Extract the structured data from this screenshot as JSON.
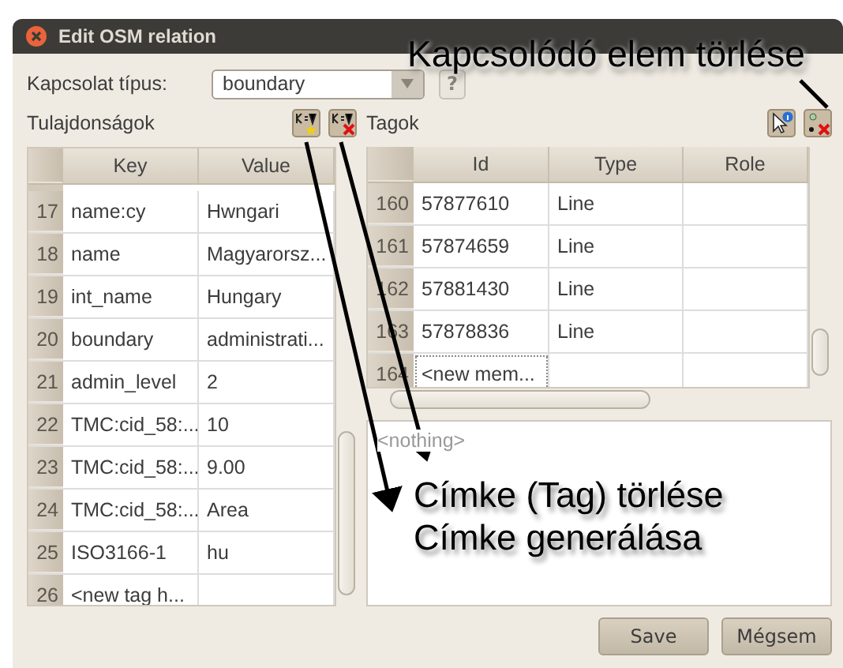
{
  "window": {
    "title": "Edit OSM relation"
  },
  "relation_type": {
    "label": "Kapcsolat típus:",
    "value": "boundary",
    "help": "?"
  },
  "tags": {
    "label": "Tulajdonságok",
    "columns": [
      "Key",
      "Value"
    ],
    "rows": [
      {
        "index": "17",
        "key": "name:cy",
        "value": "Hwngari"
      },
      {
        "index": "18",
        "key": "name",
        "value": "Magyarorsz..."
      },
      {
        "index": "19",
        "key": "int_name",
        "value": "Hungary"
      },
      {
        "index": "20",
        "key": "boundary",
        "value": "administrati..."
      },
      {
        "index": "21",
        "key": "admin_level",
        "value": "2"
      },
      {
        "index": "22",
        "key": "TMC:cid_58:...",
        "value": "10"
      },
      {
        "index": "23",
        "key": "TMC:cid_58:...",
        "value": "9.00"
      },
      {
        "index": "24",
        "key": "TMC:cid_58:...",
        "value": "Area"
      },
      {
        "index": "25",
        "key": "ISO3166-1",
        "value": "hu"
      },
      {
        "index": "26",
        "key": "<new tag h...",
        "value": ""
      }
    ]
  },
  "members": {
    "label": "Tagok",
    "columns": [
      "Id",
      "Type",
      "Role"
    ],
    "rows": [
      {
        "index": "160",
        "id": "57877610",
        "type": "Line",
        "role": "",
        "focused": false
      },
      {
        "index": "161",
        "id": "57874659",
        "type": "Line",
        "role": "",
        "focused": false
      },
      {
        "index": "162",
        "id": "57881430",
        "type": "Line",
        "role": "",
        "focused": false
      },
      {
        "index": "163",
        "id": "57878836",
        "type": "Line",
        "role": "",
        "focused": false
      },
      {
        "index": "164",
        "id": "<new mem...",
        "type": "",
        "role": "",
        "focused": true
      }
    ]
  },
  "details": {
    "text": "<nothing>"
  },
  "buttons": [
    "Save",
    "Mégsem"
  ],
  "annotations": [
    {
      "kind": "top",
      "text": "Kapcsolódó elem törlése"
    },
    {
      "kind": "bottom",
      "text": "Címke (Tag) törlése"
    },
    {
      "kind": "bottom",
      "text": "Címke generálása"
    }
  ]
}
